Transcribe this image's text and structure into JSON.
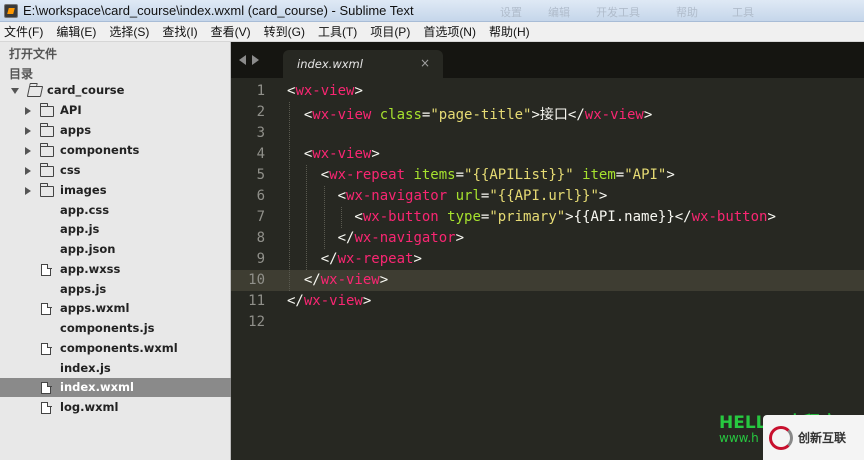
{
  "window": {
    "title": "E:\\workspace\\card_course\\index.wxml (card_course) - Sublime Text",
    "ghost_items": [
      "设置",
      "编辑",
      "开发工具",
      "帮助",
      "工具"
    ]
  },
  "menu": [
    "文件(F)",
    "编辑(E)",
    "选择(S)",
    "查找(I)",
    "查看(V)",
    "转到(G)",
    "工具(T)",
    "项目(P)",
    "首选项(N)",
    "帮助(H)"
  ],
  "sidebar": {
    "open_files_header": "打开文件",
    "folders_header": "目录",
    "root": "card_course",
    "folders": [
      "API",
      "apps",
      "components",
      "css",
      "images"
    ],
    "files": [
      {
        "name": "app.css",
        "icon": "none"
      },
      {
        "name": "app.js",
        "icon": "none"
      },
      {
        "name": "app.json",
        "icon": "none"
      },
      {
        "name": "app.wxss",
        "icon": "file-icon"
      },
      {
        "name": "apps.js",
        "icon": "none"
      },
      {
        "name": "apps.wxml",
        "icon": "file-icon"
      },
      {
        "name": "components.js",
        "icon": "none"
      },
      {
        "name": "components.wxml",
        "icon": "file-icon"
      },
      {
        "name": "index.js",
        "icon": "none"
      },
      {
        "name": "index.wxml",
        "icon": "file-icon",
        "selected": true
      },
      {
        "name": "log.wxml",
        "icon": "file-icon"
      }
    ]
  },
  "editor": {
    "tab": "index.wxml",
    "tab_close": "×",
    "current_line": 10,
    "lines": [
      [
        [
          "p",
          "<"
        ],
        [
          "t",
          "wx-view"
        ],
        [
          "p",
          ">"
        ]
      ],
      [
        [
          "p",
          "  <"
        ],
        [
          "t",
          "wx-view"
        ],
        [
          "p",
          " "
        ],
        [
          "a",
          "class"
        ],
        [
          "p",
          "="
        ],
        [
          "s",
          "\"page-title\""
        ],
        [
          "p",
          ">接口</"
        ],
        [
          "t",
          "wx-view"
        ],
        [
          "p",
          ">"
        ]
      ],
      [],
      [
        [
          "p",
          "  <"
        ],
        [
          "t",
          "wx-view"
        ],
        [
          "p",
          ">"
        ]
      ],
      [
        [
          "p",
          "    <"
        ],
        [
          "t",
          "wx-repeat"
        ],
        [
          "p",
          " "
        ],
        [
          "a",
          "items"
        ],
        [
          "p",
          "="
        ],
        [
          "s",
          "\"{{APIList}}\""
        ],
        [
          "p",
          " "
        ],
        [
          "a",
          "item"
        ],
        [
          "p",
          "="
        ],
        [
          "s",
          "\"API\""
        ],
        [
          "p",
          ">"
        ]
      ],
      [
        [
          "p",
          "      <"
        ],
        [
          "t",
          "wx-navigator"
        ],
        [
          "p",
          " "
        ],
        [
          "a",
          "url"
        ],
        [
          "p",
          "="
        ],
        [
          "s",
          "\"{{API.url}}\""
        ],
        [
          "p",
          ">"
        ]
      ],
      [
        [
          "p",
          "        <"
        ],
        [
          "t",
          "wx-button"
        ],
        [
          "p",
          " "
        ],
        [
          "a",
          "type"
        ],
        [
          "p",
          "="
        ],
        [
          "s",
          "\"primary\""
        ],
        [
          "p",
          ">{{API.name}}</"
        ],
        [
          "t",
          "wx-button"
        ],
        [
          "p",
          ">"
        ]
      ],
      [
        [
          "p",
          "      </"
        ],
        [
          "t",
          "wx-navigator"
        ],
        [
          "p",
          ">"
        ]
      ],
      [
        [
          "p",
          "    </"
        ],
        [
          "t",
          "wx-repeat"
        ],
        [
          "p",
          ">"
        ]
      ],
      [
        [
          "p",
          "  </"
        ],
        [
          "t",
          "wx-view"
        ],
        [
          "p",
          ">"
        ]
      ],
      [
        [
          "p",
          "</"
        ],
        [
          "t",
          "wx-view"
        ],
        [
          "p",
          ">"
        ]
      ],
      []
    ]
  },
  "watermark": {
    "hello": "HELLO 小程序",
    "url": "www.h",
    "brand": "创新互联"
  },
  "colors": {
    "editor_bg": "#272822",
    "tag": "#f92672",
    "attr": "#a6e22e",
    "string": "#e6db74",
    "plain": "#f8f8f2",
    "line_number": "#90908a"
  }
}
